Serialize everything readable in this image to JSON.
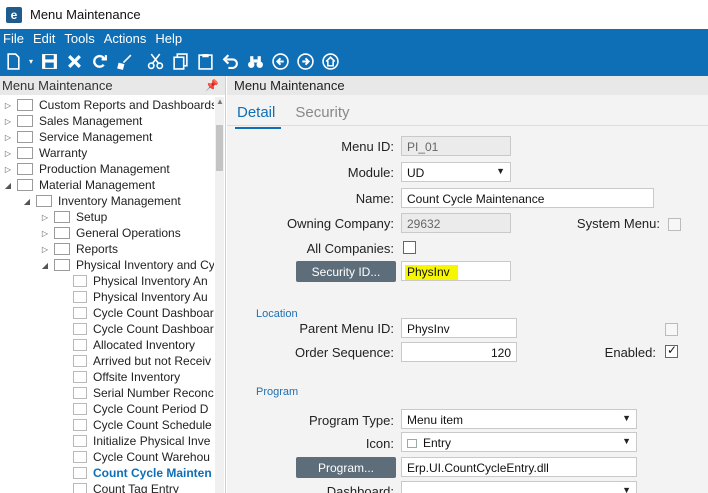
{
  "window": {
    "title": "Menu Maintenance",
    "app_icon": "e"
  },
  "menubar": [
    "File",
    "Edit",
    "Tools",
    "Actions",
    "Help"
  ],
  "toolbar": [
    "new-icon",
    "save-icon",
    "delete-icon",
    "refresh-icon",
    "clear-icon",
    "cut-icon",
    "copy-icon",
    "paste-icon",
    "undo-icon",
    "search-icon",
    "back-icon",
    "forward-icon",
    "home-icon"
  ],
  "left_panel": {
    "title": "Menu Maintenance",
    "tree": [
      {
        "label": "Custom Reports and Dashboards",
        "level": 0,
        "kind": "folder",
        "expanded": false
      },
      {
        "label": "Sales Management",
        "level": 0,
        "kind": "folder",
        "expanded": false
      },
      {
        "label": "Service Management",
        "level": 0,
        "kind": "folder",
        "expanded": false
      },
      {
        "label": "Warranty",
        "level": 0,
        "kind": "folder",
        "expanded": false
      },
      {
        "label": "Production Management",
        "level": 0,
        "kind": "folder",
        "expanded": false
      },
      {
        "label": "Material Management",
        "level": 0,
        "kind": "folder",
        "expanded": true
      },
      {
        "label": "Inventory Management",
        "level": 1,
        "kind": "folder",
        "expanded": true
      },
      {
        "label": "Setup",
        "level": 2,
        "kind": "folder",
        "expanded": false
      },
      {
        "label": "General Operations",
        "level": 2,
        "kind": "folder",
        "expanded": false
      },
      {
        "label": "Reports",
        "level": 2,
        "kind": "folder",
        "expanded": false
      },
      {
        "label": "Physical Inventory and Cy",
        "level": 2,
        "kind": "folder",
        "expanded": true
      },
      {
        "label": "Physical Inventory An",
        "level": 3,
        "kind": "doc"
      },
      {
        "label": "Physical Inventory Au",
        "level": 3,
        "kind": "doc"
      },
      {
        "label": "Cycle Count Dashboar",
        "level": 3,
        "kind": "doc"
      },
      {
        "label": "Cycle Count Dashboar",
        "level": 3,
        "kind": "doc"
      },
      {
        "label": "Allocated Inventory",
        "level": 3,
        "kind": "doc"
      },
      {
        "label": "Arrived but not Receiv",
        "level": 3,
        "kind": "doc"
      },
      {
        "label": "Offsite Inventory",
        "level": 3,
        "kind": "doc"
      },
      {
        "label": "Serial Number Reconc",
        "level": 3,
        "kind": "doc"
      },
      {
        "label": "Cycle Count Period D",
        "level": 3,
        "kind": "doc"
      },
      {
        "label": "Cycle Count Schedule",
        "level": 3,
        "kind": "doc"
      },
      {
        "label": "Initialize Physical Inve",
        "level": 3,
        "kind": "doc"
      },
      {
        "label": "Cycle Count Warehou",
        "level": 3,
        "kind": "doc"
      },
      {
        "label": "Count Cycle Mainten",
        "level": 3,
        "kind": "doc",
        "selected": true
      },
      {
        "label": "Count Tag Entry",
        "level": 3,
        "kind": "doc"
      }
    ]
  },
  "right_panel": {
    "title": "Menu Maintenance",
    "tabs": [
      "Detail",
      "Security"
    ],
    "fields": {
      "menu_id_label": "Menu ID:",
      "menu_id": "PI_01",
      "module_label": "Module:",
      "module": "UD",
      "name_label": "Name:",
      "name": "Count Cycle Maintenance",
      "owning_company_label": "Owning Company:",
      "owning_company": "29632",
      "system_menu_label": "System Menu:",
      "all_companies_label": "All Companies:",
      "security_id_button": "Security ID...",
      "security_id": "PhysInv"
    },
    "location": {
      "section": "Location",
      "parent_menu_label": "Parent Menu ID:",
      "parent_menu": "PhysInv",
      "order_sequence_label": "Order Sequence:",
      "order_sequence": "120",
      "enabled_label": "Enabled:"
    },
    "program": {
      "section": "Program",
      "program_type_label": "Program Type:",
      "program_type": "Menu item",
      "icon_label": "Icon:",
      "icon": "Entry",
      "program_button": "Program...",
      "program": "Erp.UI.CountCycleEntry.dll",
      "dashboard_label": "Dashboard:"
    },
    "colors": {
      "accent": "#0f6fb6",
      "highlight": "#f6f600",
      "button": "#5d6d7a"
    }
  }
}
